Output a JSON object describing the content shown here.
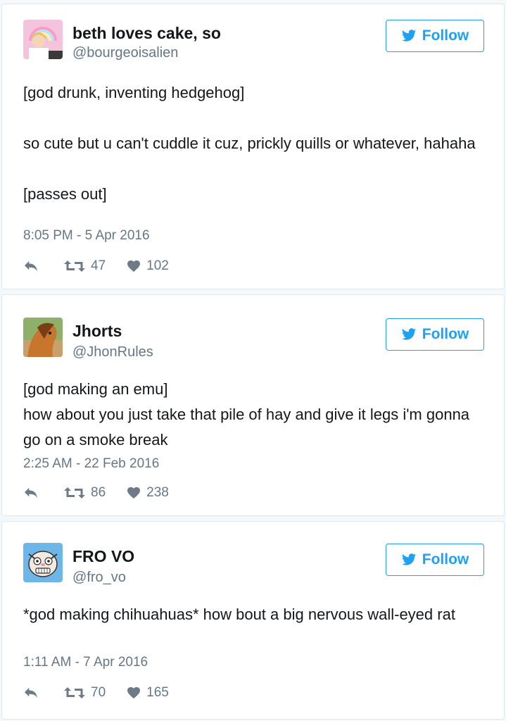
{
  "colors": {
    "accent": "#1da1f2",
    "secondary_text": "#657786",
    "border": "#e1e8ed",
    "background": "#f5f8fa"
  },
  "tweets": [
    {
      "name": "beth loves cake, so",
      "handle": "@bourgeoisalien",
      "follow_label": "Follow",
      "text": "[god drunk, inventing hedgehog]\n\nso cute but u can't cuddle it cuz, prickly quills or whatever, hahaha\n\n[passes out]",
      "timestamp": "8:05 PM - 5 Apr 2016",
      "retweets": "47",
      "likes": "102"
    },
    {
      "name": "Jhorts",
      "handle": "@JhonRules",
      "follow_label": "Follow",
      "text": "[god making an emu]\nhow about you just take that pile of hay and give it legs i'm gonna go on a smoke break",
      "timestamp": "2:25 AM - 22 Feb 2016",
      "retweets": "86",
      "likes": "238"
    },
    {
      "name": "FRO VO",
      "handle": "@fro_vo",
      "follow_label": "Follow",
      "text": "*god making chihuahuas* how bout a big nervous wall-eyed rat",
      "timestamp": "1:11 AM - 7 Apr 2016",
      "retweets": "70",
      "likes": "165"
    }
  ],
  "icons": {
    "follow": "bird-icon",
    "reply": "reply-icon",
    "retweet": "retweet-icon",
    "like": "heart-icon"
  }
}
